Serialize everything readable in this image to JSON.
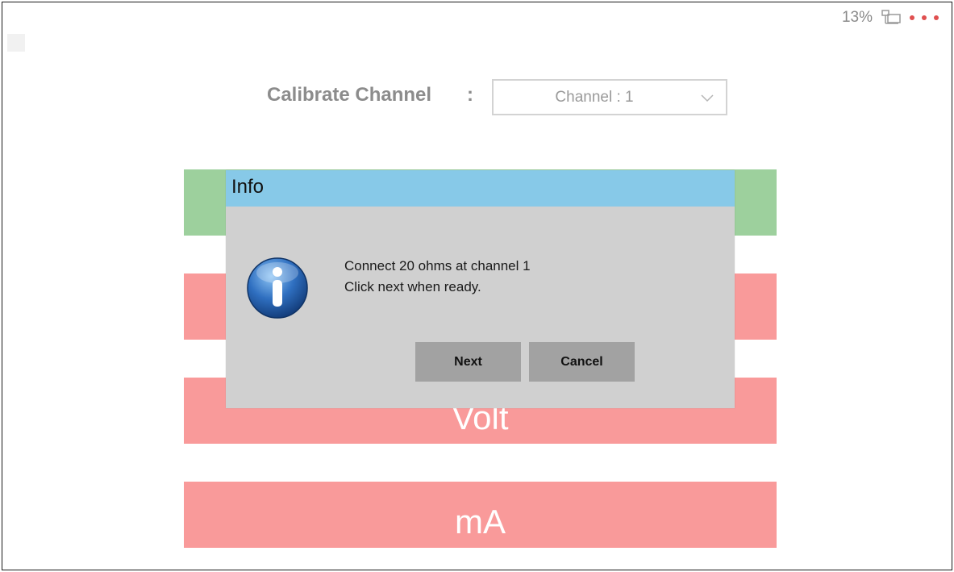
{
  "status": {
    "percent": "13%",
    "network_icon": "network-icon",
    "dots_color": "#e05050"
  },
  "calibrate": {
    "label": "Calibrate Channel",
    "colon": ":",
    "channel_value": "Channel : 1"
  },
  "buttons": {
    "bar2": "",
    "volt": "Volt",
    "ma": "mA"
  },
  "dialog": {
    "title": "Info",
    "line1": "Connect 20 ohms at channel 1",
    "line2": "Click next when ready.",
    "next_label": "Next",
    "cancel_label": "Cancel",
    "icon": "info-icon",
    "title_color": "#87c9e8"
  },
  "colors": {
    "green_bar": "#9dd09d",
    "red_bar": "#f99a9a",
    "dialog_bg": "#d0d0d0"
  }
}
